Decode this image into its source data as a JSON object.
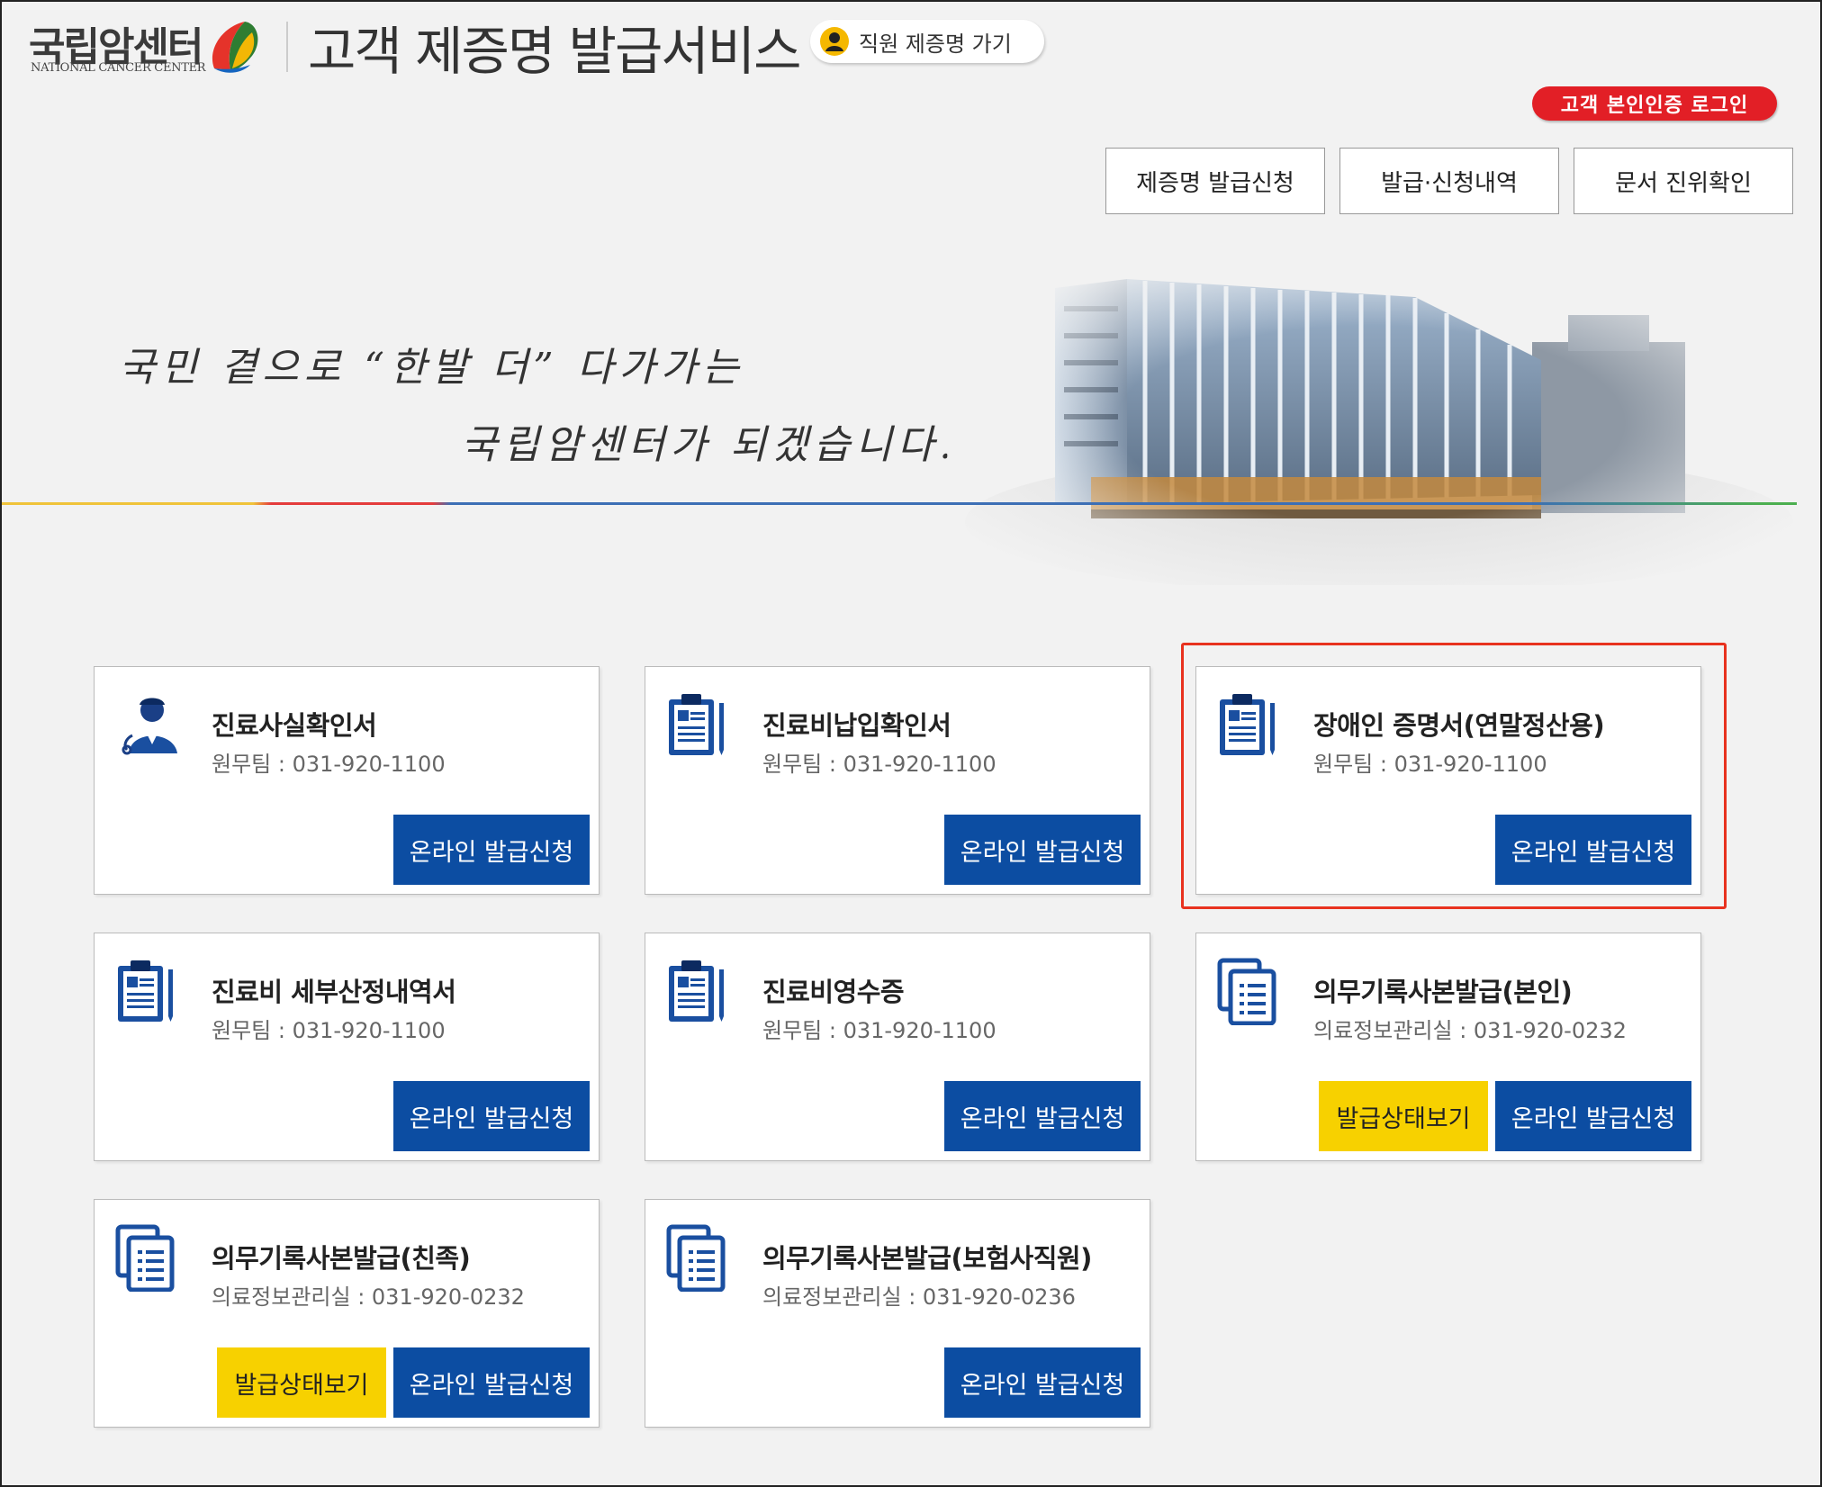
{
  "header": {
    "logo_ko": "국립암센터",
    "logo_en": "NATIONAL CANCER CENTER",
    "title": "고객 제증명 발급서비스",
    "staff_link": "직원 제증명 가기",
    "login_button": "고객 본인인증 로그인",
    "nav": [
      {
        "label": "제증명 발급신청"
      },
      {
        "label": "발급·신청내역"
      },
      {
        "label": "문서 진위확인"
      }
    ]
  },
  "banner": {
    "slogan_line1": "국민 곁으로 “한발 더” 다가가는",
    "slogan_line2": "국립암센터가 되겠습니다."
  },
  "cards": [
    {
      "title": "진료사실확인서",
      "phone": "원무팀 : 031-920-1100",
      "icon": "doctor-icon",
      "online": "온라인 발급신청"
    },
    {
      "title": "진료비납입확인서",
      "phone": "원무팀 : 031-920-1100",
      "icon": "clipboard-icon",
      "online": "온라인 발급신청"
    },
    {
      "title": "장애인 증명서(연말정산용)",
      "phone": "원무팀 : 031-920-1100",
      "icon": "clipboard-icon",
      "online": "온라인 발급신청"
    },
    {
      "title": "진료비 세부산정내역서",
      "phone": "원무팀 : 031-920-1100",
      "icon": "clipboard-icon",
      "online": "온라인 발급신청"
    },
    {
      "title": "진료비영수증",
      "phone": "원무팀 : 031-920-1100",
      "icon": "clipboard-icon",
      "online": "온라인 발급신청"
    },
    {
      "title": "의무기록사본발급(본인)",
      "phone": "의료정보관리실 : 031-920-0232",
      "icon": "documents-icon",
      "online": "온라인 발급신청",
      "status": "발급상태보기"
    },
    {
      "title": "의무기록사본발급(친족)",
      "phone": "의료정보관리실 : 031-920-0232",
      "icon": "documents-icon",
      "online": "온라인 발급신청",
      "status": "발급상태보기"
    },
    {
      "title": "의무기록사본발급(보험사직원)",
      "phone": "의료정보관리실 : 031-920-0236",
      "icon": "documents-icon",
      "online": "온라인 발급신청"
    }
  ],
  "colors": {
    "primary_blue": "#0c4da2",
    "status_yellow": "#f7d100",
    "login_red": "#e21f26",
    "highlight_red": "#e8321f"
  }
}
